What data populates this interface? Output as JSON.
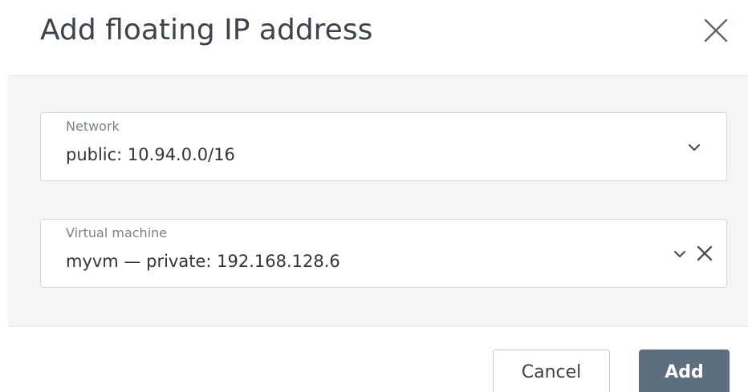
{
  "dialog": {
    "title": "Add floating IP address",
    "close_icon": "close-icon"
  },
  "fields": {
    "network": {
      "label": "Network",
      "value": "public: 10.94.0.0/16",
      "icon": "chevron-down-icon"
    },
    "virtual_machine": {
      "label": "Virtual machine",
      "value": "myvm — private: 192.168.128.6",
      "icons": [
        "chevron-down-icon",
        "clear-icon"
      ]
    }
  },
  "footer": {
    "cancel_label": "Cancel",
    "add_label": "Add"
  },
  "colors": {
    "primary_button": "#5d6f7e",
    "body_background": "#f4f5f6",
    "field_border": "#d5d9dd"
  }
}
